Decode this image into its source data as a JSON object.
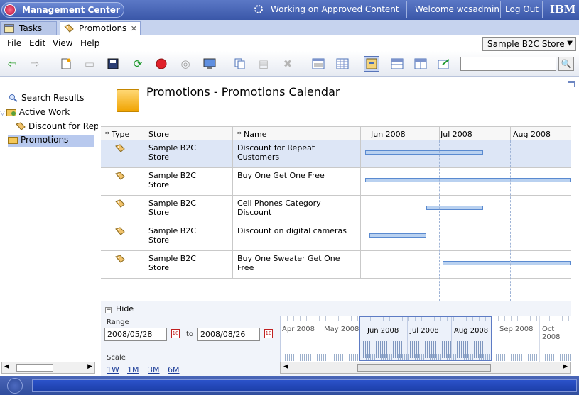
{
  "header": {
    "app_title": "Management Center",
    "work_status": "Working on Approved Content",
    "welcome": "Welcome wcsadmin",
    "logout": "Log Out",
    "ibm_logo": "IBM"
  },
  "tabs": [
    {
      "label": "Tasks",
      "icon": "tasks-icon"
    },
    {
      "label": "Promotions",
      "icon": "promotion-icon",
      "close": "✕"
    }
  ],
  "menu": {
    "items": [
      "File",
      "Edit",
      "View",
      "Help"
    ],
    "store_selector": "Sample B2C Store",
    "store_selector_arrow": "▼"
  },
  "toolbar": {
    "icons": [
      "back-icon",
      "forward-icon",
      "new-icon",
      "open-icon",
      "save-icon",
      "refresh-icon",
      "stop-icon",
      "find-icon",
      "preview-icon",
      "copy-icon",
      "paste-icon",
      "delete-icon",
      "list-view-icon",
      "grid-view-icon",
      "calendar-view-icon",
      "horizontal-split-icon",
      "vertical-split-icon",
      "export-icon"
    ],
    "search_placeholder": "",
    "search_icon": "🔍"
  },
  "nav": {
    "search_results": "Search Results",
    "active_work": "Active Work",
    "active_work_child": "Discount for Repeat",
    "promotions": "Promotions",
    "scroll_left": "◀",
    "scroll_right": "▶"
  },
  "main": {
    "title": "Promotions - Promotions Calendar",
    "columns": [
      "* Type",
      "Store",
      "* Name"
    ],
    "months": [
      "Jun 2008",
      "Jul 2008",
      "Aug 2008"
    ],
    "rows": [
      {
        "store_line1": "Sample B2C",
        "store_line2": "Store",
        "name_line1": "Discount for Repeat",
        "name_line2": "Customers",
        "start": 0.02,
        "end": 0.58,
        "selected": true
      },
      {
        "store_line1": "Sample B2C",
        "store_line2": "Store",
        "name_line1": "Buy One Get One Free",
        "name_line2": "",
        "start": 0.02,
        "end": 1.0,
        "selected": false
      },
      {
        "store_line1": "Sample B2C",
        "store_line2": "Store",
        "name_line1": "Cell Phones Category",
        "name_line2": "Discount",
        "start": 0.31,
        "end": 0.58,
        "selected": false
      },
      {
        "store_line1": "Sample B2C",
        "store_line2": "Store",
        "name_line1": "Discount on digital cameras",
        "name_line2": "",
        "start": 0.04,
        "end": 0.31,
        "selected": false
      },
      {
        "store_line1": "Sample B2C",
        "store_line2": "Store",
        "name_line1": "Buy One Sweater Get One",
        "name_line2": "Free",
        "start": 0.39,
        "end": 1.0,
        "selected": false
      }
    ]
  },
  "range": {
    "hide": "Hide",
    "hide_toggle": "−",
    "range_label": "Range",
    "from": "2008/05/28",
    "to_label": "to",
    "to": "2008/08/26",
    "calendar_icon": "10",
    "scale_label": "Scale",
    "scales": [
      "1W",
      "1M",
      "3M",
      "6M"
    ],
    "timeline_months": [
      "Apr 2008",
      "May 2008",
      "Jun 2008",
      "Jul 2008",
      "Aug 2008",
      "Sep 2008",
      "Oct 2008"
    ],
    "scroll_left": "◀",
    "scroll_right": "▶"
  }
}
